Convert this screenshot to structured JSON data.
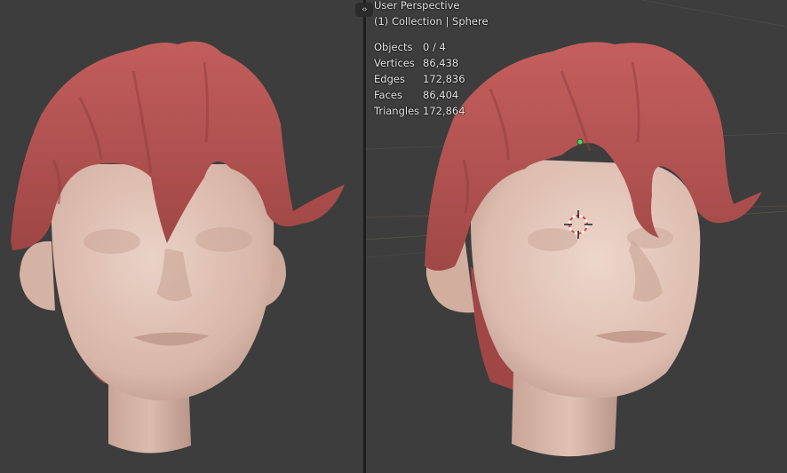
{
  "viewport_right": {
    "view_name": "User Perspective",
    "collection": "(1) Collection | Sphere",
    "stats": [
      {
        "label": "Objects",
        "value": "0 / 4"
      },
      {
        "label": "Vertices",
        "value": "86,438"
      },
      {
        "label": "Edges",
        "value": "172,836"
      },
      {
        "label": "Faces",
        "value": "86,404"
      },
      {
        "label": "Triangles",
        "value": "172,864"
      }
    ]
  },
  "toggle": {
    "icon": "chevron-left-right-icon",
    "glyph": "‹›"
  },
  "colors": {
    "background": "#3d3d3d",
    "hair": "#b85656",
    "skin": "#dcbcae",
    "divider": "#1d1d1d",
    "origin_dot": "#4cd96a",
    "cursor_red": "#e04040"
  }
}
